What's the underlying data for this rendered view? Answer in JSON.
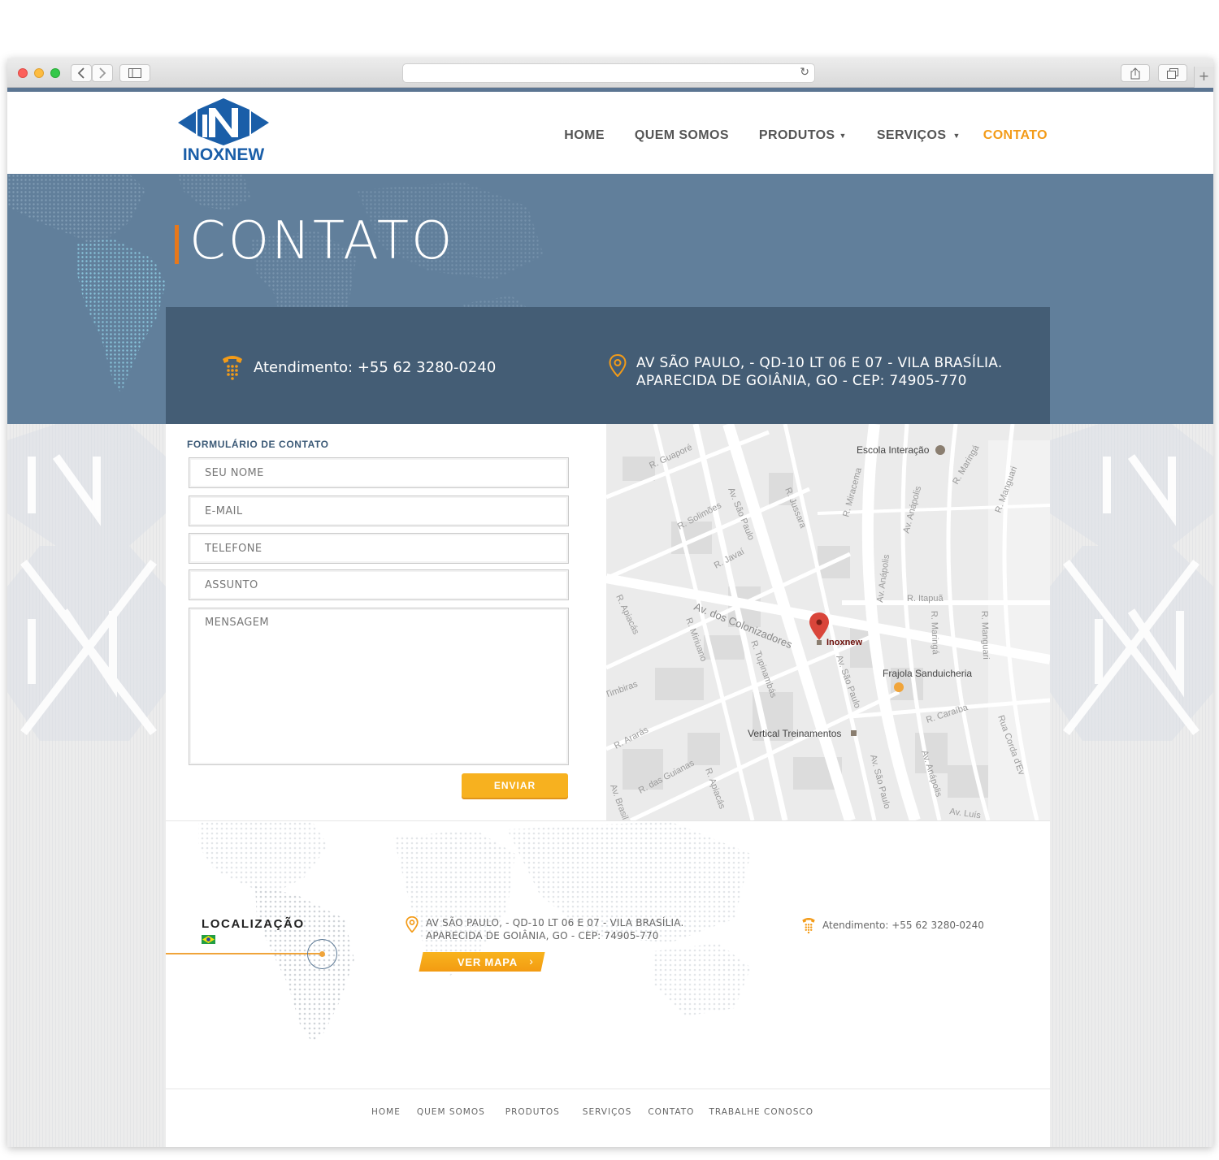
{
  "brand": {
    "name": "INOXNEW",
    "primary_color": "#1a5ea8",
    "accent_color": "#f39b18"
  },
  "nav": {
    "items": [
      {
        "label": "HOME",
        "dropdown": false,
        "active": false
      },
      {
        "label": "QUEM SOMOS",
        "dropdown": false,
        "active": false
      },
      {
        "label": "PRODUTOS",
        "dropdown": true,
        "active": false
      },
      {
        "label": "SERVIÇOS",
        "dropdown": true,
        "active": false
      },
      {
        "label": "CONTATO",
        "dropdown": false,
        "active": true
      }
    ]
  },
  "hero": {
    "title": "CONTATO",
    "phone": "Atendimento: +55 62 3280-0240",
    "address_line1": "AV SÃO PAULO, - QD-10 LT 06 E 07 - VILA BRASÍLIA.",
    "address_line2": "APARECIDA DE GOIÂNIA, GO - CEP: 74905-770"
  },
  "form": {
    "title": "FORMULÁRIO DE CONTATO",
    "name_placeholder": "SEU NOME",
    "email_placeholder": "E-MAIL",
    "phone_placeholder": "TELEFONE",
    "subject_placeholder": "ASSUNTO",
    "message_placeholder": "MENSAGEM",
    "submit_label": "ENVIAR"
  },
  "map": {
    "marker_label": "Inoxnew",
    "places": [
      "Escola Interação",
      "Frajola Sanduicheria",
      "Vertical Treinamentos"
    ],
    "streets": [
      "R. Guaporé",
      "Av. São Paulo",
      "R. Solimões",
      "R. Javaí",
      "R. Jussara",
      "R. Miracema",
      "Av. Anápolis",
      "R. Maringá",
      "R. Manguari",
      "R. Itapuã",
      "Av. dos Colonizadores",
      "R. Apiacás",
      "R. Miriuano",
      "R. Tupinambás",
      "R. Caraíba",
      "R. Ararás",
      "R. das Guianas",
      "Timbiras",
      "Av. Brasil",
      "Av. Luís",
      "Rua Corda d'Ev"
    ]
  },
  "location": {
    "title": "LOCALIZAÇÃO",
    "address_line1": "AV SÃO PAULO, - QD-10 LT 06 E 07 - VILA BRASÍLIA.",
    "address_line2": "APARECIDA DE GOIÂNIA, GO - CEP: 74905-770",
    "map_button": "VER MAPA",
    "phone": "Atendimento: +55 62 3280-0240"
  },
  "footer": {
    "links": [
      "HOME",
      "QUEM SOMOS",
      "PRODUTOS",
      "SERVIÇOS",
      "CONTATO",
      "TRABALHE CONOSCO"
    ]
  },
  "icons": {
    "phone": "phone-icon",
    "location": "map-pin-icon",
    "flag": "brazil-flag-icon"
  }
}
